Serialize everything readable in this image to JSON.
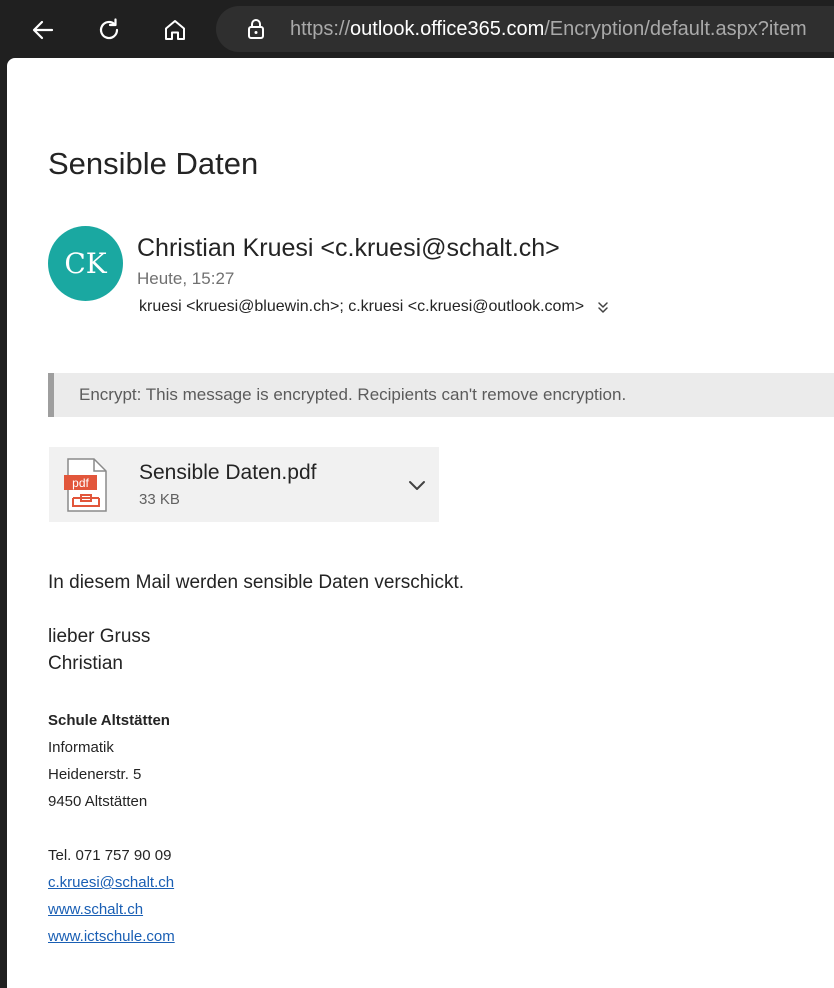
{
  "browser": {
    "url_prefix": "https://",
    "url_host": "outlook.office365.com",
    "url_path": "/Encryption/default.aspx?item"
  },
  "email": {
    "subject": "Sensible Daten",
    "avatar_initials": "CK",
    "avatar_color": "#1aa8a1",
    "sender": "Christian Kruesi <c.kruesi@schalt.ch>",
    "time": "Heute, 15:27",
    "recipients": "kruesi <kruesi@bluewin.ch>; c.kruesi <c.kruesi@outlook.com>",
    "banner": "Encrypt: This message is encrypted. Recipients can't remove encryption.",
    "attachment": {
      "name": "Sensible Daten.pdf",
      "size": "33 KB",
      "icon": "pdf-file-icon",
      "icon_color": "#e2563b"
    },
    "body": {
      "line1": "In diesem Mail werden sensible Daten verschickt.",
      "greeting": "lieber Gruss",
      "name": "Christian"
    },
    "signature": {
      "org": "Schule Altstätten",
      "dept": "Informatik",
      "street": "Heidenerstr. 5",
      "city": "9450 Altstätten",
      "tel": "Tel. 071 757 90 09",
      "email": "c.kruesi@schalt.ch",
      "web1": "www.schalt.ch",
      "web2": "www.ictschule.com",
      "link_color": "#1a5fb4"
    }
  }
}
